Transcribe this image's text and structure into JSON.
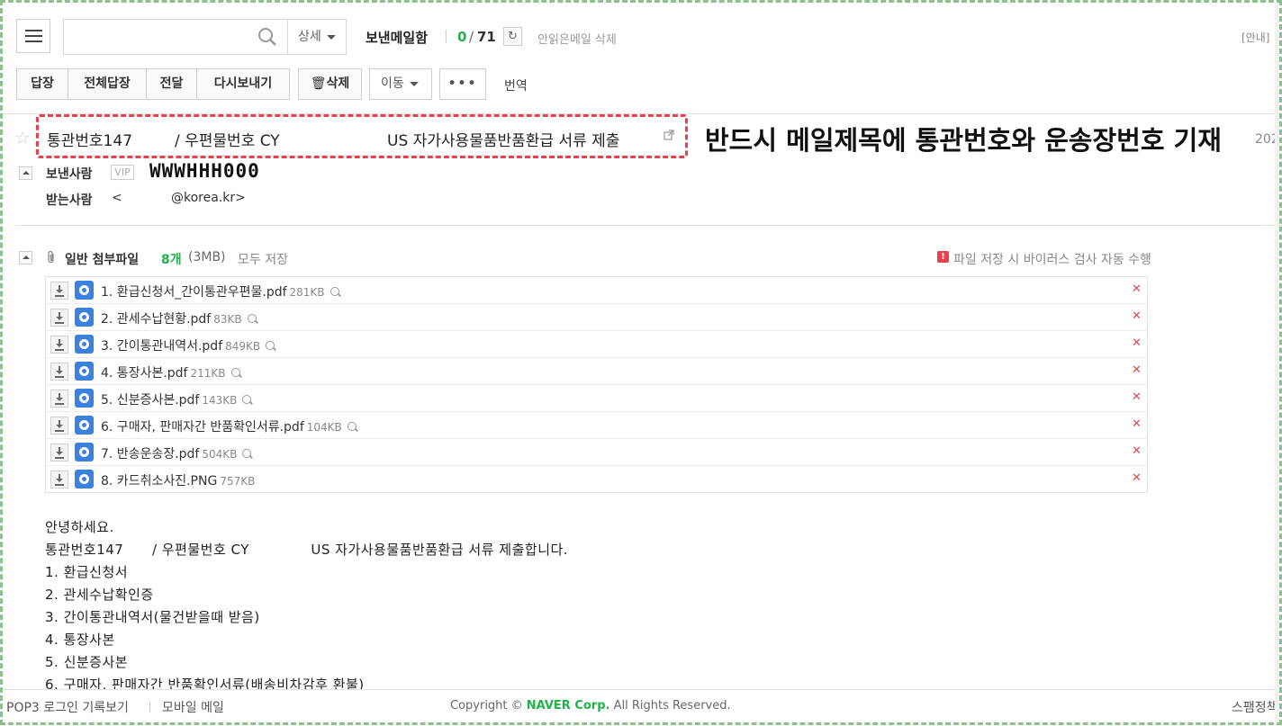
{
  "toolbar": {
    "detail_label": "상세",
    "folder_title": "보낸메일함",
    "unread": "0",
    "slash": "/",
    "total": "71",
    "delete_unread": "안읽은메일 삭제",
    "guide": "[안내]"
  },
  "actions": {
    "reply": "답장",
    "reply_all": "전체답장",
    "forward": "전달",
    "resend": "다시보내기",
    "delete": "삭제",
    "move": "이동",
    "more": "•••",
    "translate": "번역"
  },
  "mail": {
    "subject_part1": "통관번호147",
    "subject_part2": "/ 우편물번호 CY",
    "subject_part3": "US 자가사용물품반품환급 서류 제출",
    "annotation": "반드시 메일제목에 통관번호와 운송장번호 기재",
    "date_fragment": "202",
    "sender_label": "보낸사람",
    "vip": "VIP",
    "sender_name": "WWWHHH000",
    "recipient_label": "받는사람",
    "recipient_prefix": "<",
    "recipient_email": "@korea.kr>"
  },
  "attachments": {
    "label": "일반 첨부파일",
    "count": "8개",
    "size": "(3MB)",
    "save_all": "모두 저장",
    "virus_notice": "파일 저장 시 바이러스 검사 자동 수행",
    "files": [
      {
        "name": "1. 환급신청서_간이통관우편물.pdf",
        "size": "281KB"
      },
      {
        "name": "2. 관세수납현황.pdf",
        "size": "83KB"
      },
      {
        "name": "3. 간이통관내역서.pdf",
        "size": "849KB"
      },
      {
        "name": "4. 통장사본.pdf",
        "size": "211KB"
      },
      {
        "name": "5. 신분증사본.pdf",
        "size": "143KB"
      },
      {
        "name": "6. 구매자, 판매자간 반품확인서류.pdf",
        "size": "104KB"
      },
      {
        "name": "7. 반송운송장.pdf",
        "size": "504KB"
      },
      {
        "name": "8. 카드취소사진.PNG",
        "size": "757KB"
      }
    ]
  },
  "body": {
    "lines": [
      "안녕하세요.",
      "통관번호147      / 우편물번호 CY             US 자가사용물품반품환급 서류 제출합니다.",
      "1. 환급신청서",
      "2. 관세수납확인증",
      "3. 간이통관내역서(물건받을때 받음)",
      "4. 통장사본",
      "5. 신분증사본",
      "6. 구매자, 판매자간 반품확인서류(배송비차감후 환불)"
    ]
  },
  "footer": {
    "pop3": "POP3 로그인 기록보기",
    "mobile": "모바일 메일",
    "copyright_prefix": "Copyright © ",
    "copyright_brand": "NAVER Corp.",
    "copyright_suffix": " All Rights Reserved.",
    "spam": "스팸정책"
  }
}
